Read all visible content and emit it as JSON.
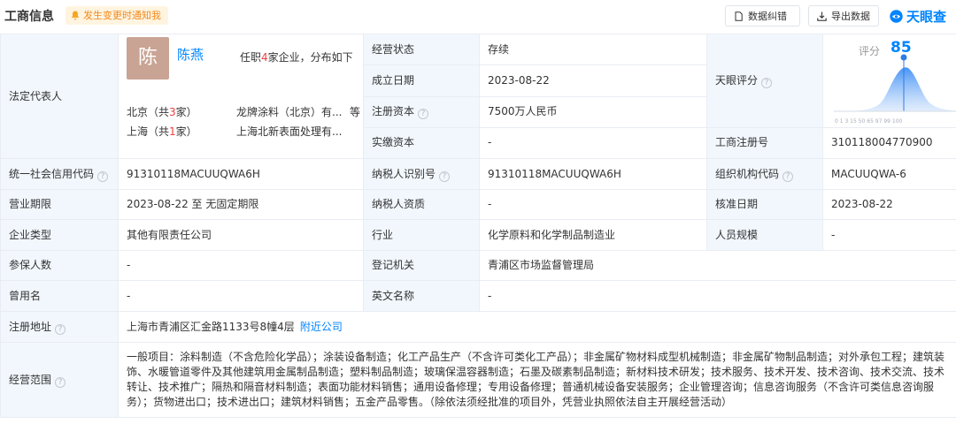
{
  "header": {
    "title": "工商信息",
    "notify_label": "发生变更时通知我",
    "feedback_label": "数据纠错",
    "export_label": "导出数据",
    "logo_text": "天眼查"
  },
  "legal_rep": {
    "label": "法定代表人",
    "avatar_char": "陈",
    "name": "陈燕",
    "summary_pre": "任职",
    "company_count": "4",
    "summary_post": "家企业，分布如下",
    "dist": [
      {
        "city_pre": "北京（共",
        "count": "3",
        "city_post": "家）",
        "company": "龙牌涂料（北京）有...",
        "more": "等"
      },
      {
        "city_pre": "上海（共",
        "count": "1",
        "city_post": "家）",
        "company": "上海北新表面处理有...",
        "more": ""
      }
    ]
  },
  "score": {
    "label": "天眼评分",
    "title": "评分",
    "value": "85",
    "ticks": "0 1 3 15 50 65 97 99 100"
  },
  "fields": {
    "status": {
      "label": "经营状态",
      "value": "存续"
    },
    "founded": {
      "label": "成立日期",
      "value": "2023-08-22"
    },
    "reg_capital": {
      "label": "注册资本",
      "value": "7500万人民币"
    },
    "paid_capital": {
      "label": "实缴资本",
      "value": "-"
    },
    "reg_no": {
      "label": "工商注册号",
      "value": "310118004770900"
    },
    "credit_code": {
      "label": "统一社会信用代码",
      "value": "91310118MACUUQWA6H"
    },
    "taxpayer_id": {
      "label": "纳税人识别号",
      "value": "91310118MACUUQWA6H"
    },
    "org_code": {
      "label": "组织机构代码",
      "value": "MACUUQWA-6"
    },
    "term": {
      "label": "营业期限",
      "value": "2023-08-22 至 无固定期限"
    },
    "taxpayer_qual": {
      "label": "纳税人资质",
      "value": "-"
    },
    "approval_date": {
      "label": "核准日期",
      "value": "2023-08-22"
    },
    "company_type": {
      "label": "企业类型",
      "value": "其他有限责任公司"
    },
    "industry": {
      "label": "行业",
      "value": "化学原料和化学制品制造业"
    },
    "staff_size": {
      "label": "人员规模",
      "value": "-"
    },
    "insured": {
      "label": "参保人数",
      "value": "-"
    },
    "authority": {
      "label": "登记机关",
      "value": "青浦区市场监督管理局"
    },
    "former_name": {
      "label": "曾用名",
      "value": "-"
    },
    "english_name": {
      "label": "英文名称",
      "value": "-"
    },
    "address": {
      "label": "注册地址",
      "value": "上海市青浦区汇金路1133号8幢4层",
      "link": "附近公司"
    },
    "scope": {
      "label": "经营范围",
      "value": "一般项目：涂料制造（不含危险化学品）；涂装设备制造；化工产品生产（不含许可类化工产品）；非金属矿物材料成型机械制造；非金属矿物制品制造；对外承包工程；建筑装饰、水暖管道零件及其他建筑用金属制品制造；塑料制品制造；玻璃保温容器制造；石墨及碳素制品制造；新材料技术研发；技术服务、技术开发、技术咨询、技术交流、技术转让、技术推广；隔热和隔音材料制造；表面功能材料销售；通用设备修理；专用设备修理；普通机械设备安装服务；企业管理咨询；信息咨询服务（不含许可类信息咨询服务）；货物进出口；技术进出口；建筑材料销售；五金产品零售。（除依法须经批准的项目外，凭营业执照依法自主开展经营活动）"
    }
  },
  "colors": {
    "accent": "#0084ff",
    "label_bg": "#f2f7fd",
    "border": "#e9edf3",
    "warn": "#f08a1e",
    "red": "#f04040"
  }
}
